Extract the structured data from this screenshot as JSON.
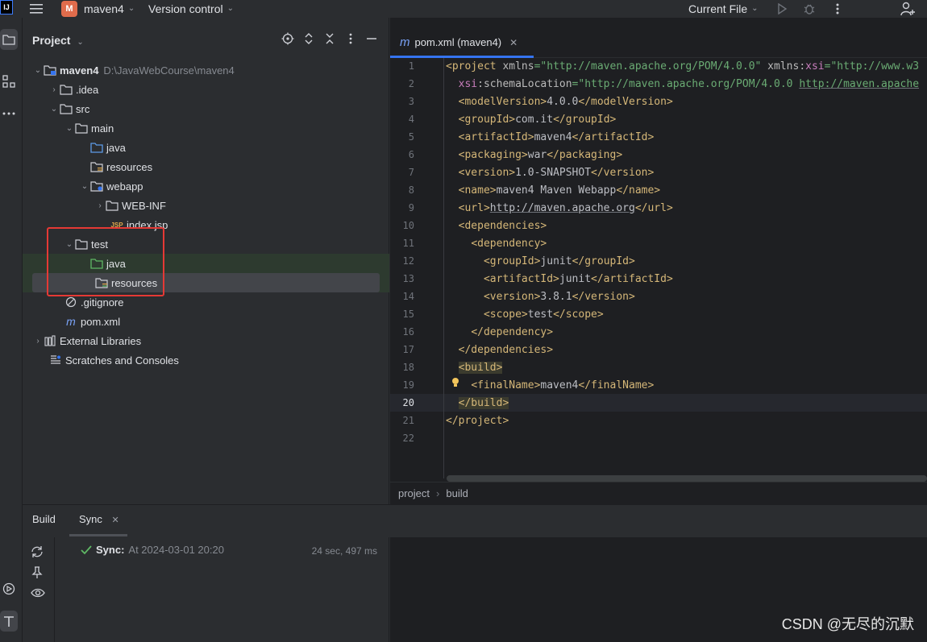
{
  "titlebar": {
    "app_logo": "IJ",
    "menu_icon": "hamburger-menu-icon",
    "project_badge": "M",
    "project_name": "maven4",
    "vcs_label": "Version control",
    "run_config": "Current File"
  },
  "project_panel": {
    "title": "Project",
    "tree": [
      {
        "label": "maven4",
        "path": "D:\\JavaWebCourse\\maven4",
        "icon": "module-folder-icon"
      },
      {
        "label": ".idea",
        "icon": "folder-icon"
      },
      {
        "label": "src",
        "icon": "folder-icon"
      },
      {
        "label": "main",
        "icon": "folder-icon"
      },
      {
        "label": "java",
        "icon": "source-root-icon"
      },
      {
        "label": "resources",
        "icon": "resources-root-icon"
      },
      {
        "label": "webapp",
        "icon": "web-folder-icon"
      },
      {
        "label": "WEB-INF",
        "icon": "folder-icon"
      },
      {
        "label": "index.jsp",
        "icon": "jsp-file-icon"
      },
      {
        "label": "test",
        "icon": "folder-icon"
      },
      {
        "label": "java",
        "icon": "test-source-root-icon"
      },
      {
        "label": "resources",
        "icon": "test-resources-root-icon"
      },
      {
        "label": ".gitignore",
        "icon": "ignore-file-icon"
      },
      {
        "label": "pom.xml",
        "icon": "maven-file-icon"
      },
      {
        "label": "External Libraries",
        "icon": "library-icon"
      },
      {
        "label": "Scratches and Consoles",
        "icon": "scratches-icon"
      }
    ]
  },
  "editor": {
    "tab_label": "pom.xml (maven4)",
    "line_numbers": [
      "1",
      "2",
      "3",
      "4",
      "5",
      "6",
      "7",
      "8",
      "9",
      "10",
      "11",
      "12",
      "13",
      "14",
      "15",
      "16",
      "17",
      "18",
      "19",
      "20",
      "21",
      "22"
    ],
    "breadcrumb": [
      "project",
      "build"
    ],
    "code": {
      "l1_tag": "<project",
      "l1_a1": " xmlns",
      "l1_v1": "=\"http://maven.apache.org/POM/4.0.0\"",
      "l1_a2": " xmlns:",
      "l1_ns": "xsi",
      "l1_v2": "=\"http://www.w3",
      "l2_ns": "xsi",
      "l2_a": ":schemaLocation",
      "l2_v1": "=\"http://maven.apache.org/POM/4.0.0 ",
      "l2_v2": "http://maven.apache",
      "l3_open": "<modelVersion>",
      "l3_text": "4.0.0",
      "l3_close": "</modelVersion>",
      "l4_open": "<groupId>",
      "l4_text": "com.it",
      "l4_close": "</groupId>",
      "l5_open": "<artifactId>",
      "l5_text": "maven4",
      "l5_close": "</artifactId>",
      "l6_open": "<packaging>",
      "l6_text": "war",
      "l6_close": "</packaging>",
      "l7_open": "<version>",
      "l7_text": "1.0-SNAPSHOT",
      "l7_close": "</version>",
      "l8_open": "<name>",
      "l8_text": "maven4 Maven Webapp",
      "l8_close": "</name>",
      "l9_open": "<url>",
      "l9_text": "http://maven.apache.org",
      "l9_close": "</url>",
      "l10": "<dependencies>",
      "l11": "<dependency>",
      "l12_open": "<groupId>",
      "l12_text": "junit",
      "l12_close": "</groupId>",
      "l13_open": "<artifactId>",
      "l13_text": "junit",
      "l13_close": "</artifactId>",
      "l14_open": "<version>",
      "l14_text": "3.8.1",
      "l14_close": "</version>",
      "l15_open": "<scope>",
      "l15_text": "test",
      "l15_close": "</scope>",
      "l16": "</dependency>",
      "l17": "</dependencies>",
      "l18": "<build>",
      "l19_open": "<finalName>",
      "l19_text": "maven4",
      "l19_close": "</finalName>",
      "l20": "</build>",
      "l21": "</project>"
    }
  },
  "bottom": {
    "tab_build": "Build",
    "tab_sync": "Sync",
    "sync_label": "Sync:",
    "sync_time": "At 2024-03-01 20:20",
    "sync_duration": "24 sec, 497 ms"
  },
  "watermark": "CSDN @无尽的沉默",
  "colors": {
    "accent": "#3574f0",
    "highlight_box": "#e53935",
    "success": "#5fb865",
    "xml_tag": "#d5b778",
    "xml_value": "#6aab73"
  }
}
